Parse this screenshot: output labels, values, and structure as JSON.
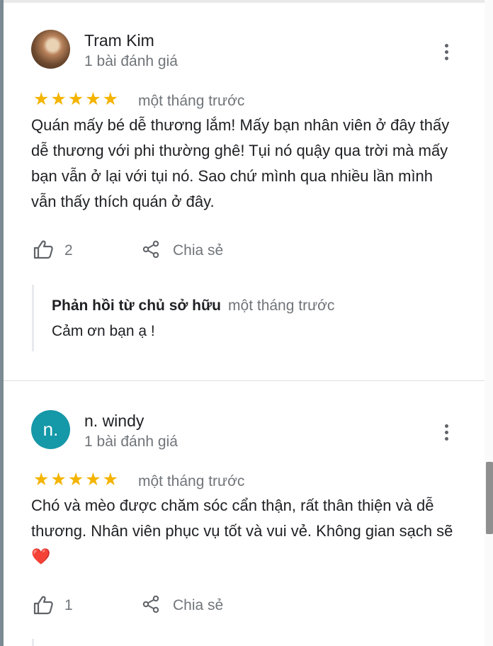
{
  "reviews": [
    {
      "name": "Tram Kim",
      "review_count": "1 bài đánh giá",
      "rating": 5,
      "stars": "★★★★★",
      "time": "một tháng trước",
      "text": "Quán mấy bé dễ thương lắm! Mấy bạn nhân viên ở đây thấy dễ thương với phi thường ghê! Tụi nó quậy qua trời mà mấy bạn vẫn ở lại với tụi nó. Sao chứ mình qua nhiều lần mình vẫn thấy thích quán ở đây.",
      "likes": "2",
      "share_label": "Chia sẻ",
      "owner_reply": {
        "label": "Phản hồi từ chủ sở hữu",
        "time": "một tháng trước",
        "text": "Cảm ơn bạn ạ !"
      }
    },
    {
      "name": "n. windy",
      "avatar_letter": "n.",
      "review_count": "1 bài đánh giá",
      "rating": 5,
      "stars": "★★★★★",
      "time": "một tháng trước",
      "text": "Chó và mèo được chăm sóc cẩn thận, rất thân thiện và dễ thương. Nhân viên phục vụ tốt và vui vẻ. Không gian sạch sẽ ❤️",
      "likes": "1",
      "share_label": "Chia sẻ"
    }
  ],
  "colors": {
    "star": "#f4b400",
    "avatar_teal": "#1598a8",
    "secondary_text": "#70757a"
  },
  "icons": [
    "more-vert-icon",
    "thumbs-up-icon",
    "share-icon",
    "heart-emoji"
  ]
}
